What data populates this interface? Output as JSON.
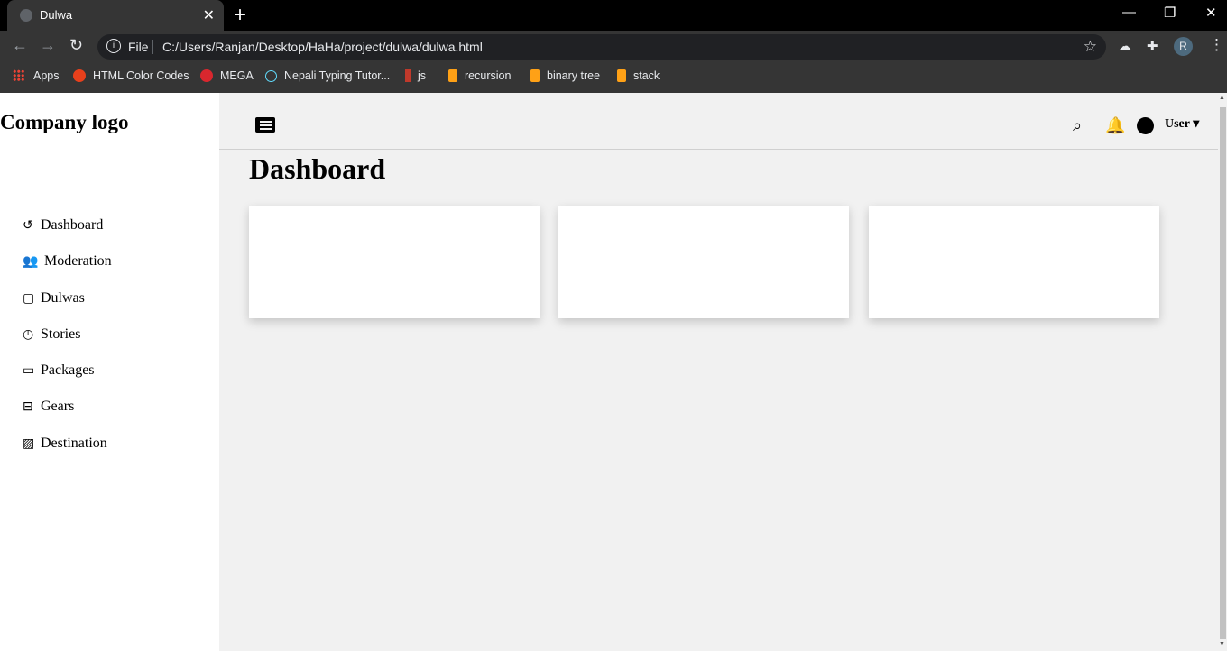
{
  "browser": {
    "tab_title": "Dulwa",
    "tab_close": "✕",
    "new_tab": "+",
    "window_controls": [
      "—",
      "❐",
      "✕"
    ],
    "file_label": "File",
    "url": "C:/Users/Ranjan/Desktop/HaHa/project/dulwa/dulwa.html",
    "profile_initial": "R",
    "bookmarks": [
      {
        "label": "Apps",
        "icon": "apps-grid-icon"
      },
      {
        "label": "HTML Color Codes",
        "icon": "html-color-codes-icon",
        "color": "#e8401c"
      },
      {
        "label": "MEGA",
        "icon": "mega-icon",
        "color": "#d9272e"
      },
      {
        "label": "Nepali Typing Tutor...",
        "icon": "react-icon",
        "color": "#61dafb"
      },
      {
        "label": "js",
        "icon": "js-icon",
        "color": "#c0392b"
      },
      {
        "label": "recursion",
        "icon": "leetcode-icon",
        "color": "#ffa116"
      },
      {
        "label": "binary tree",
        "icon": "leetcode-icon",
        "color": "#ffa116"
      },
      {
        "label": "stack",
        "icon": "leetcode-icon",
        "color": "#ffa116"
      }
    ]
  },
  "sidebar": {
    "logo": "Company logo",
    "items": [
      {
        "label": "Dashboard",
        "icon": "history-icon"
      },
      {
        "label": "Moderation",
        "icon": "users-icon"
      },
      {
        "label": "Dulwas",
        "icon": "note-icon"
      },
      {
        "label": "Stories",
        "icon": "clock-icon"
      },
      {
        "label": "Packages",
        "icon": "window-icon"
      },
      {
        "label": "Gears",
        "icon": "minus-square-icon"
      },
      {
        "label": "Destination",
        "icon": "image-icon"
      }
    ]
  },
  "header": {
    "user_label": "User"
  },
  "main": {
    "title": "Dashboard",
    "cards": [
      {},
      {},
      {}
    ]
  }
}
